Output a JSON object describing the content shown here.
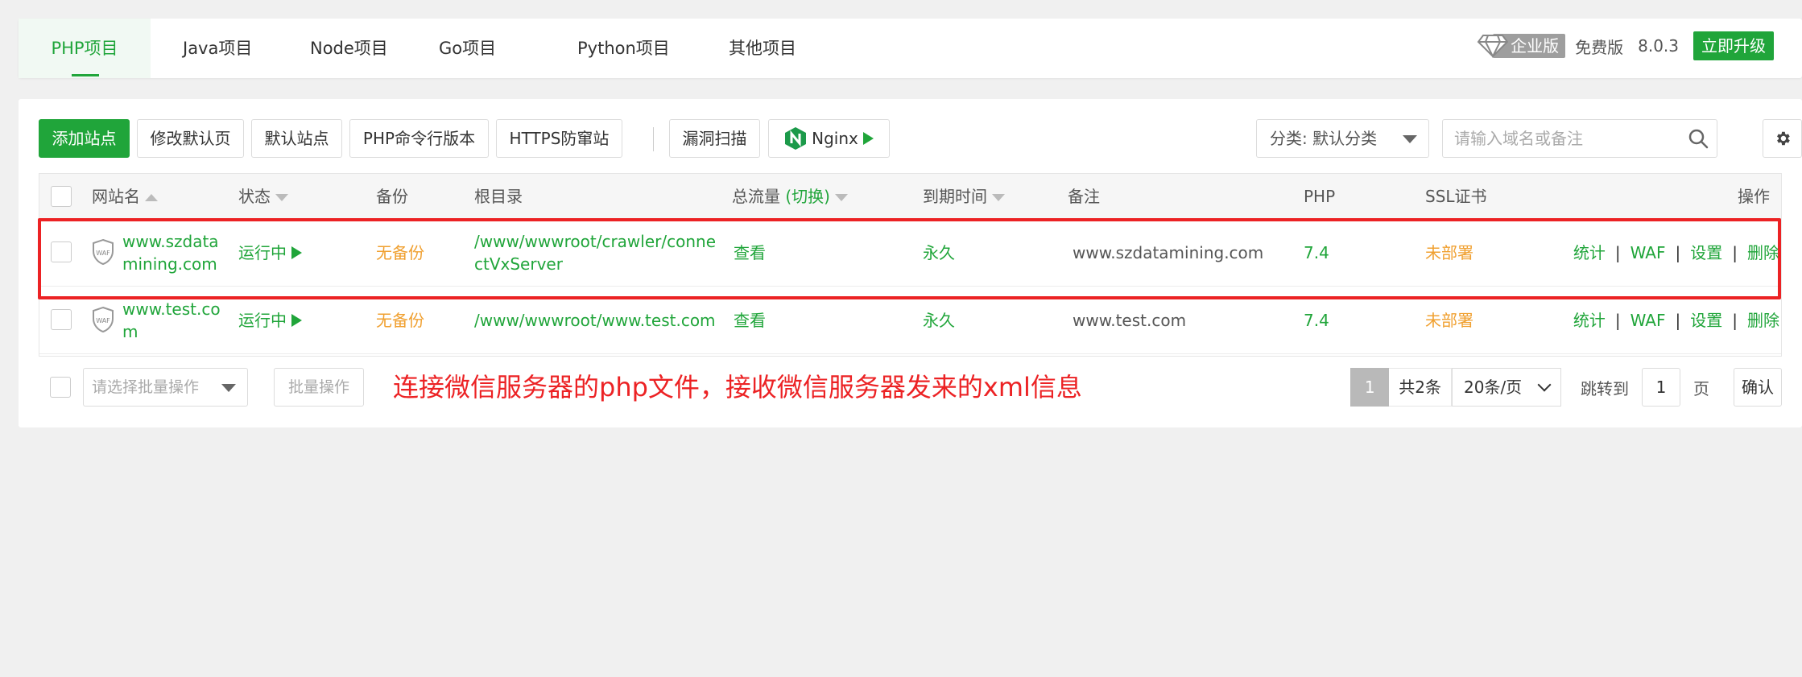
{
  "tabs": [
    {
      "label": "PHP项目",
      "active": true
    },
    {
      "label": "Java项目"
    },
    {
      "label": "Node项目"
    },
    {
      "label": "Go项目"
    },
    {
      "label": "Python项目"
    },
    {
      "label": "其他项目"
    }
  ],
  "version": {
    "enterprise_label": "企业版",
    "free_label": "免费版",
    "number": "8.0.3",
    "upgrade_label": "立即升级"
  },
  "toolbar": {
    "add_site": "添加站点",
    "edit_default_page": "修改默认页",
    "default_site": "默认站点",
    "php_cli_version": "PHP命令行版本",
    "https_protect": "HTTPS防窜站",
    "vuln_scan": "漏洞扫描",
    "nginx_label": "Nginx",
    "category_label": "分类: 默认分类",
    "search_placeholder": "请输入域名或备注"
  },
  "table": {
    "headers": {
      "site_name": "网站名",
      "status": "状态",
      "backup": "备份",
      "root_dir": "根目录",
      "traffic": "总流量",
      "traffic_switch": "(切换)",
      "expire": "到期时间",
      "remark": "备注",
      "php": "PHP",
      "ssl": "SSL证书",
      "ops": "操作"
    },
    "rows": [
      {
        "name_line1": "www.szdata",
        "name_line2": "mining.com",
        "status": "运行中",
        "backup": "无备份",
        "root_line1": "/www/wwwroot/crawler/conne",
        "root_line2": "ctVxServer",
        "traffic": "查看",
        "expire": "永久",
        "remark": "www.szdatamining.com",
        "php": "7.4",
        "ssl": "未部署"
      },
      {
        "name_line1": "www.test.co",
        "name_line2": "m",
        "status": "运行中",
        "backup": "无备份",
        "root_line1": "/www/wwwroot/www.test.com",
        "root_line2": "",
        "traffic": "查看",
        "expire": "永久",
        "remark": "www.test.com",
        "php": "7.4",
        "ssl": "未部署"
      }
    ],
    "ops": {
      "stats": "统计",
      "waf": "WAF",
      "settings": "设置",
      "delete": "删除",
      "separator": "|"
    }
  },
  "footer": {
    "batch_placeholder": "请选择批量操作",
    "batch_button": "批量操作",
    "annotation": "连接微信服务器的php文件，接收微信服务器发来的xml信息",
    "page_current": "1",
    "total": "共2条",
    "page_size": "20条/页",
    "jump_label": "跳转到",
    "jump_value": "1",
    "page_label": "页",
    "confirm": "确认"
  },
  "icons": {
    "waf_shield_text": "WAF"
  },
  "colors": {
    "accent": "#20a53a",
    "warning": "#f0a030",
    "annotation_red": "#ec2224"
  }
}
